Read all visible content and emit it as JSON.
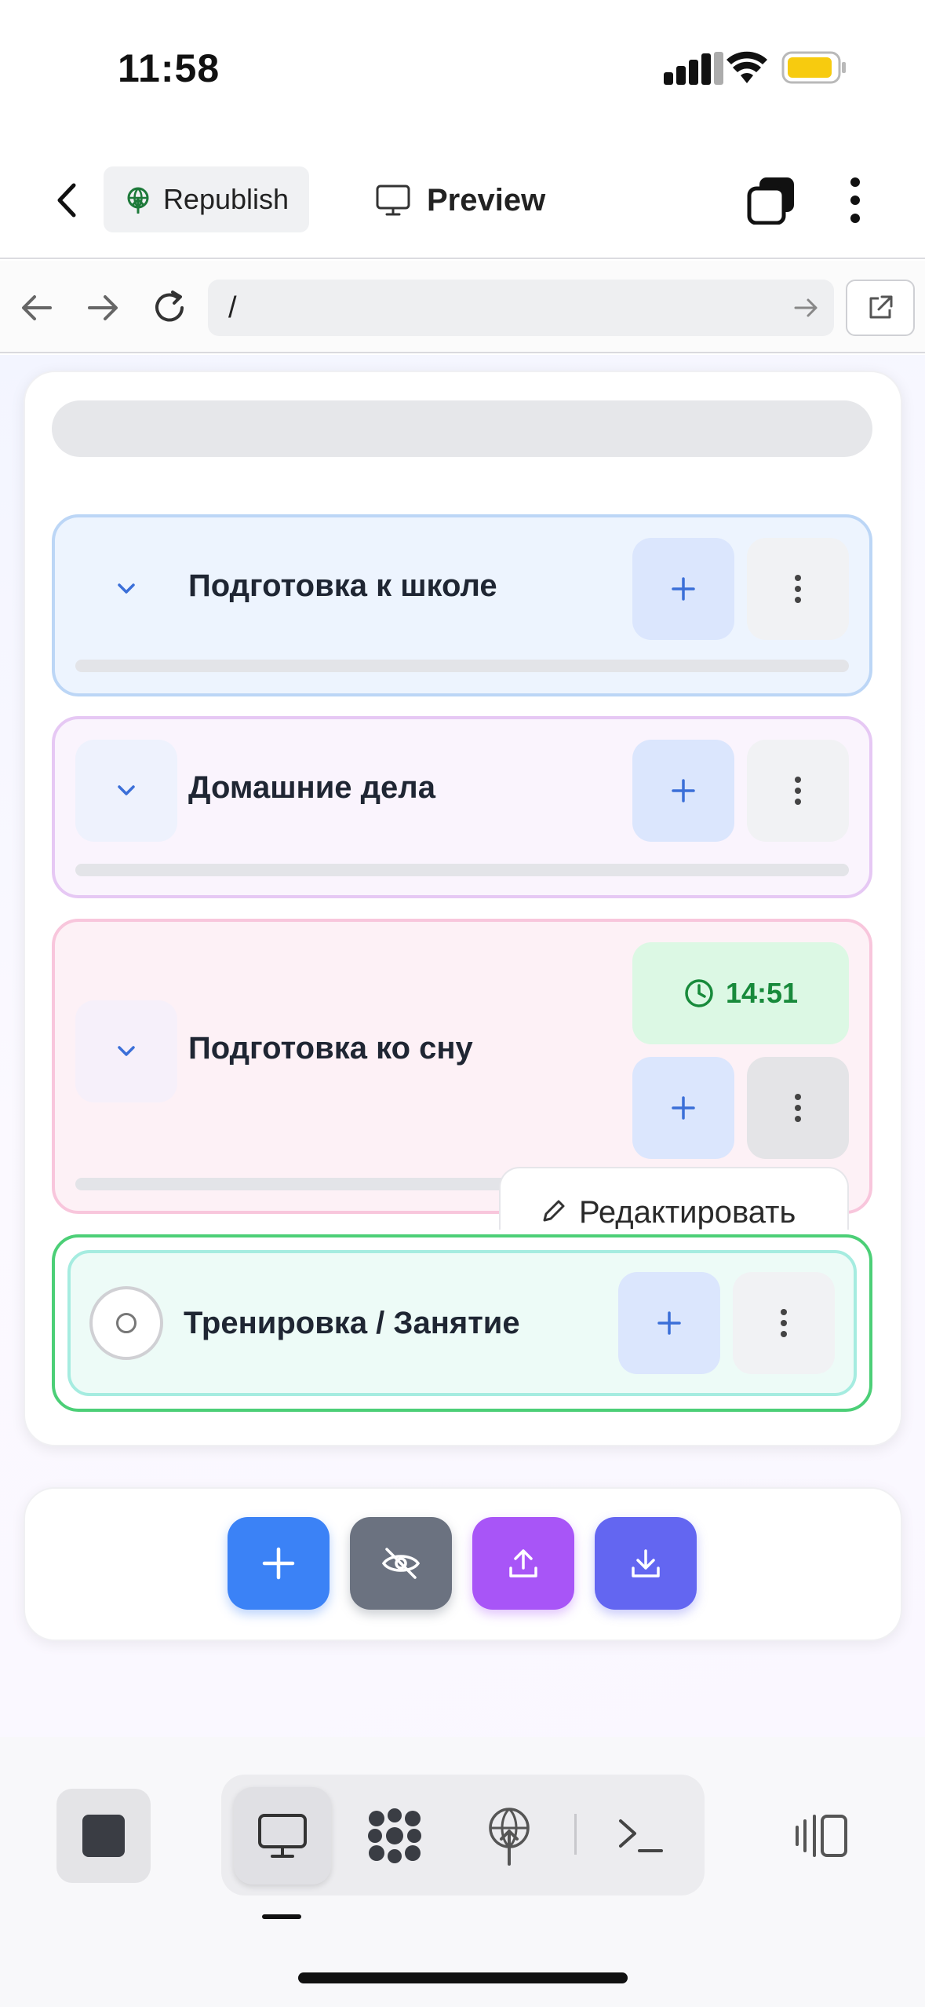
{
  "status_bar": {
    "time": "11:58"
  },
  "toolbar": {
    "republish_label": "Republish",
    "preview_label": "Preview"
  },
  "browser": {
    "url": "/"
  },
  "tasks": [
    {
      "title": "Подготовка к школе",
      "theme": "blue"
    },
    {
      "title": "Домашние дела",
      "theme": "purple"
    },
    {
      "title": "Подготовка ко сну",
      "theme": "pink",
      "timer": "14:51"
    },
    {
      "title": "Тренировка / Занятие",
      "theme": "green"
    }
  ],
  "dropdown": {
    "first_item": "Редактировать"
  },
  "colors": {
    "blue_border": "#bcd6f6",
    "purple_border": "#e6c8f4",
    "pink_border": "#f8c6dc",
    "green_border": "#4ccf77",
    "add_button": "#3b82f6",
    "hide_button": "#6b7280",
    "upload_button": "#a855f7",
    "download_button": "#6366f1"
  }
}
